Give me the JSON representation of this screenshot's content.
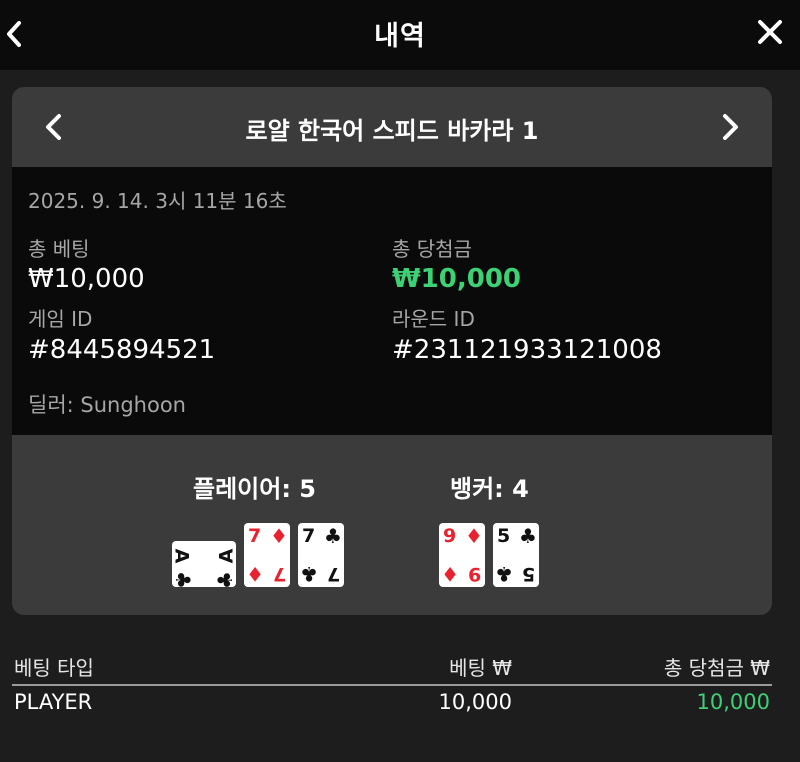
{
  "header": {
    "title": "내역",
    "back_icon": "chevron-left-icon",
    "close_icon": "close-icon"
  },
  "card": {
    "table_name": "로얄 한국어 스피드 바카라 1",
    "prev_icon": "chevron-left-icon",
    "next_icon": "chevron-right-icon"
  },
  "details": {
    "datetime": "2025. 9. 14. 3시 11분 16초",
    "total_bet_label": "총 베팅",
    "total_bet_value": "₩10,000",
    "total_win_label": "총 당첨금",
    "total_win_value": "₩10,000",
    "game_id_label": "게임 ID",
    "game_id_value": "#8445894521",
    "round_id_label": "라운드 ID",
    "round_id_value": "#231121933121008",
    "dealer": "딜러: Sunghoon"
  },
  "results": {
    "player_score": "플레이어: 5",
    "banker_score": "뱅커: 4",
    "player_cards": [
      {
        "rank": "A",
        "suit": "♣",
        "orientation": "horizontal"
      },
      {
        "rank": "7",
        "suit": "♦"
      },
      {
        "rank": "7",
        "suit": "♣"
      }
    ],
    "banker_cards": [
      {
        "rank": "9",
        "suit": "♦"
      },
      {
        "rank": "5",
        "suit": "♣"
      }
    ]
  },
  "bets_table": {
    "headers": [
      "베팅 타입",
      "베팅 ₩",
      "총 당첨금 ₩"
    ],
    "rows": [
      {
        "type": "PLAYER",
        "bet": "10,000",
        "win": "10,000"
      }
    ]
  },
  "colors": {
    "win_green": "#3dd176",
    "card_red": "#e8232e",
    "panel": "#3b3b3b"
  }
}
